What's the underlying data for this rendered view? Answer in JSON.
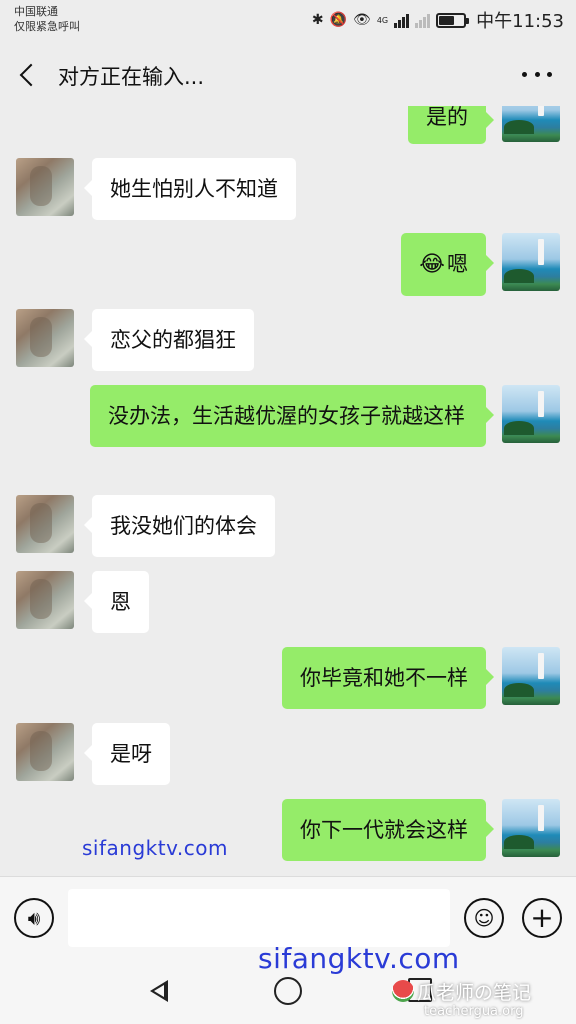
{
  "status_bar": {
    "carrier": "中国联通",
    "emergency": "仅限紧急呼叫",
    "network": "4G",
    "time": "中午11:53",
    "battery_level": 0.6,
    "icons": [
      "bluetooth-icon",
      "mute-icon",
      "eye-icon",
      "signal-icon",
      "battery-icon"
    ]
  },
  "header": {
    "title": "对方正在输入..."
  },
  "messages": [
    {
      "side": "right",
      "text": "是的"
    },
    {
      "side": "left",
      "text": "她生怕别人不知道"
    },
    {
      "side": "right",
      "emoji": "😂",
      "text": "嗯"
    },
    {
      "side": "left",
      "text": "恋父的都猖狂"
    },
    {
      "side": "right",
      "text": "没办法，生活越优渥的女孩子就越这样"
    },
    {
      "side": "left",
      "text": "我没她们的体会"
    },
    {
      "side": "left",
      "text": "恩"
    },
    {
      "side": "right",
      "text": "你毕竟和她不一样"
    },
    {
      "side": "left",
      "text": "是呀"
    },
    {
      "side": "right",
      "text": "你下一代就会这样"
    }
  ],
  "input_bar": {
    "value": "",
    "placeholder": "",
    "icons": [
      "voice-icon",
      "emoji-icon",
      "plus-icon"
    ]
  },
  "watermarks": {
    "site_small": "sifangktv.com",
    "site_large": "sifangktv.com",
    "blog_name": "瓜老师の笔记",
    "blog_url": "teachergua.org"
  },
  "colors": {
    "background": "#ededed",
    "outgoing_bubble": "#95ec69",
    "incoming_bubble": "#ffffff",
    "watermark_blue": "#2a3bd6"
  }
}
